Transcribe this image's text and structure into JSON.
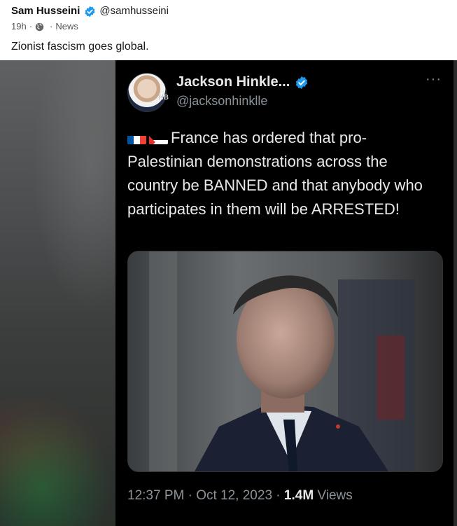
{
  "post": {
    "author_name": "Sam Husseini",
    "author_handle": "@samhusseini",
    "time": "19h",
    "category": "News",
    "text": "Zionist fascism goes global."
  },
  "tweet": {
    "name": "Jackson Hinkle...",
    "handle": "@jacksonhinklle",
    "more": "···",
    "avatar_badge": "HB",
    "text": "France has ordered that pro-Palestinian demonstrations across the country be BANNED and that anybody who participates in them will be ARRESTED!",
    "flags": [
      "france-flag",
      "palestine-flag"
    ],
    "timestamp": "12:37 PM · Oct 12, 2023 ·",
    "views_count": "1.4M",
    "views_label": "Views"
  },
  "colors": {
    "verified": "#1d9bf0",
    "tweet_bg": "#000000",
    "tweet_text": "#e7e9ea",
    "tweet_muted": "#8b9298"
  }
}
